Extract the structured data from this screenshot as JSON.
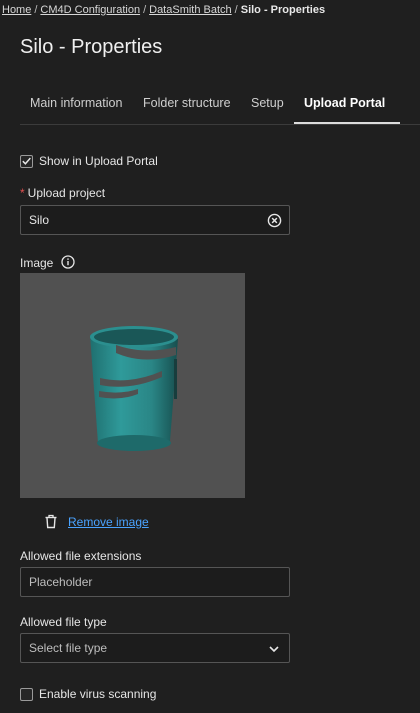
{
  "breadcrumb": {
    "items": [
      "Home",
      "CM4D Configuration",
      "DataSmith Batch"
    ],
    "separator": "/",
    "current": "Silo - Properties"
  },
  "page": {
    "title": "Silo - Properties"
  },
  "tabs": [
    {
      "label": "Main information",
      "active": false
    },
    {
      "label": "Folder structure",
      "active": false
    },
    {
      "label": "Setup",
      "active": false
    },
    {
      "label": "Upload Portal",
      "active": true
    }
  ],
  "upload_portal": {
    "show_in_portal": {
      "label": "Show in Upload Portal",
      "checked": true
    },
    "upload_project": {
      "required_mark": "*",
      "label": "Upload project",
      "value": "Silo"
    },
    "image": {
      "label": "Image",
      "remove_label": "Remove image",
      "background": "#515151",
      "model_color": "#2e8e8e"
    },
    "allowed_extensions": {
      "label": "Allowed file extensions",
      "placeholder": "Placeholder"
    },
    "allowed_file_type": {
      "label": "Allowed file type",
      "placeholder": "Select file type"
    },
    "virus_scanning": {
      "label": "Enable virus scanning",
      "checked": false
    }
  },
  "icons": {
    "clear": "close-circle-icon",
    "info": "info-icon",
    "remove": "trash-icon",
    "dropdown": "chevron-down-icon",
    "check": "check-icon"
  },
  "colors": {
    "background": "#1f1f1f",
    "link": "#4aa3ff",
    "required": "#e05050",
    "active_tab_underline": "#dcdcdc"
  }
}
